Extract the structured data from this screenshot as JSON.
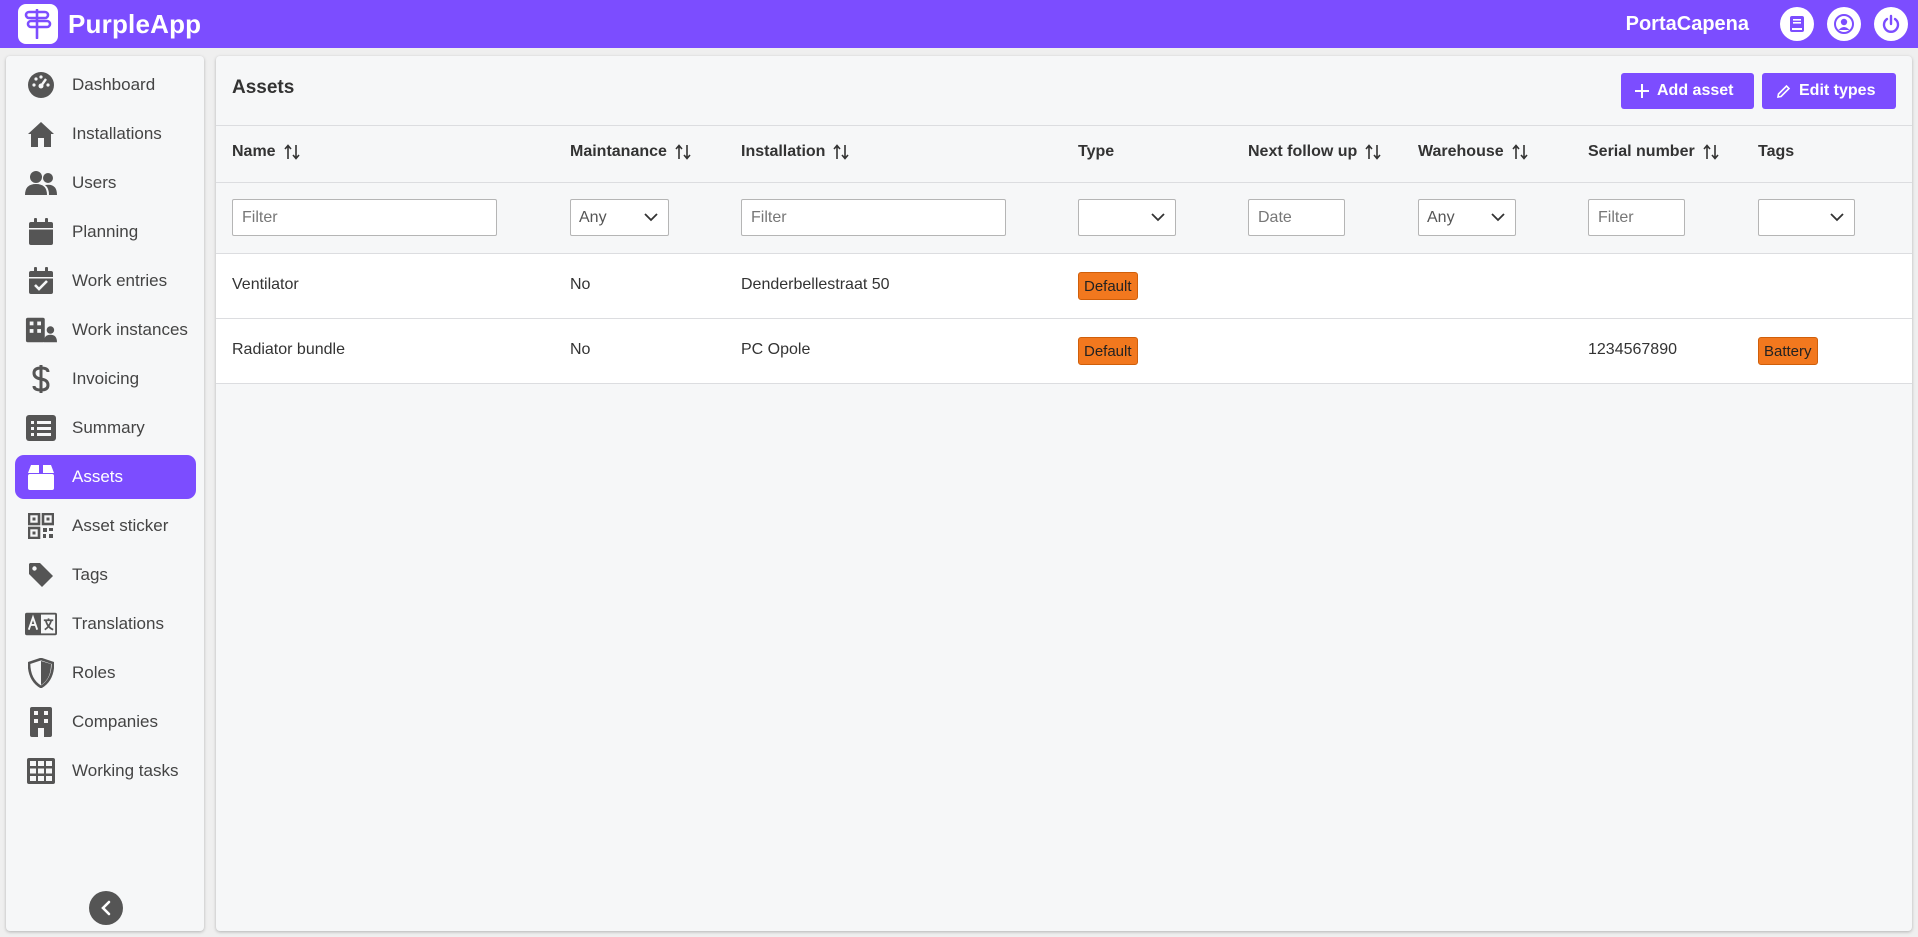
{
  "app": {
    "name": "PurpleApp",
    "company": "PortaCapena",
    "brand_color": "#7c4dff",
    "badge_color": "#f2781e"
  },
  "topbar": {
    "icons": [
      "book-icon",
      "user-icon",
      "power-icon"
    ]
  },
  "sidebar": {
    "items": [
      {
        "label": "Dashboard",
        "icon": "gauge-icon"
      },
      {
        "label": "Installations",
        "icon": "house-icon"
      },
      {
        "label": "Users",
        "icon": "users-icon"
      },
      {
        "label": "Planning",
        "icon": "calendar-icon"
      },
      {
        "label": "Work entries",
        "icon": "calendar-check-icon"
      },
      {
        "label": "Work instances",
        "icon": "building-user-icon"
      },
      {
        "label": "Invoicing",
        "icon": "dollar-icon"
      },
      {
        "label": "Summary",
        "icon": "list-icon"
      },
      {
        "label": "Assets",
        "icon": "box-icon",
        "active": true
      },
      {
        "label": "Asset sticker",
        "icon": "qrcode-icon"
      },
      {
        "label": "Tags",
        "icon": "tag-icon"
      },
      {
        "label": "Translations",
        "icon": "language-icon"
      },
      {
        "label": "Roles",
        "icon": "shield-icon"
      },
      {
        "label": "Companies",
        "icon": "building-icon"
      },
      {
        "label": "Working tasks",
        "icon": "grid-icon"
      }
    ]
  },
  "page": {
    "title": "Assets",
    "add_label": "Add asset",
    "edit_label": "Edit types"
  },
  "table": {
    "columns": [
      {
        "label": "Name",
        "sortable": true
      },
      {
        "label": "Maintanance",
        "sortable": true
      },
      {
        "label": "Installation",
        "sortable": true
      },
      {
        "label": "Type",
        "sortable": false
      },
      {
        "label": "Next follow up",
        "sortable": true
      },
      {
        "label": "Warehouse",
        "sortable": true
      },
      {
        "label": "Serial number",
        "sortable": true
      },
      {
        "label": "Tags",
        "sortable": false
      }
    ],
    "filters": {
      "name_placeholder": "Filter",
      "maintenance_value": "Any",
      "installation_placeholder": "Filter",
      "type_value": "",
      "next_follow_up_placeholder": "Date",
      "warehouse_value": "Any",
      "serial_placeholder": "Filter",
      "tags_value": ""
    },
    "rows": [
      {
        "name": "Ventilator",
        "maintenance": "No",
        "installation": "Denderbellestraat 50",
        "type": "Default",
        "next_follow_up": "",
        "warehouse": "",
        "serial_number": "",
        "tags": ""
      },
      {
        "name": "Radiator bundle",
        "maintenance": "No",
        "installation": "PC Opole",
        "type": "Default",
        "next_follow_up": "",
        "warehouse": "",
        "serial_number": "1234567890",
        "tags": "Battery"
      }
    ]
  }
}
